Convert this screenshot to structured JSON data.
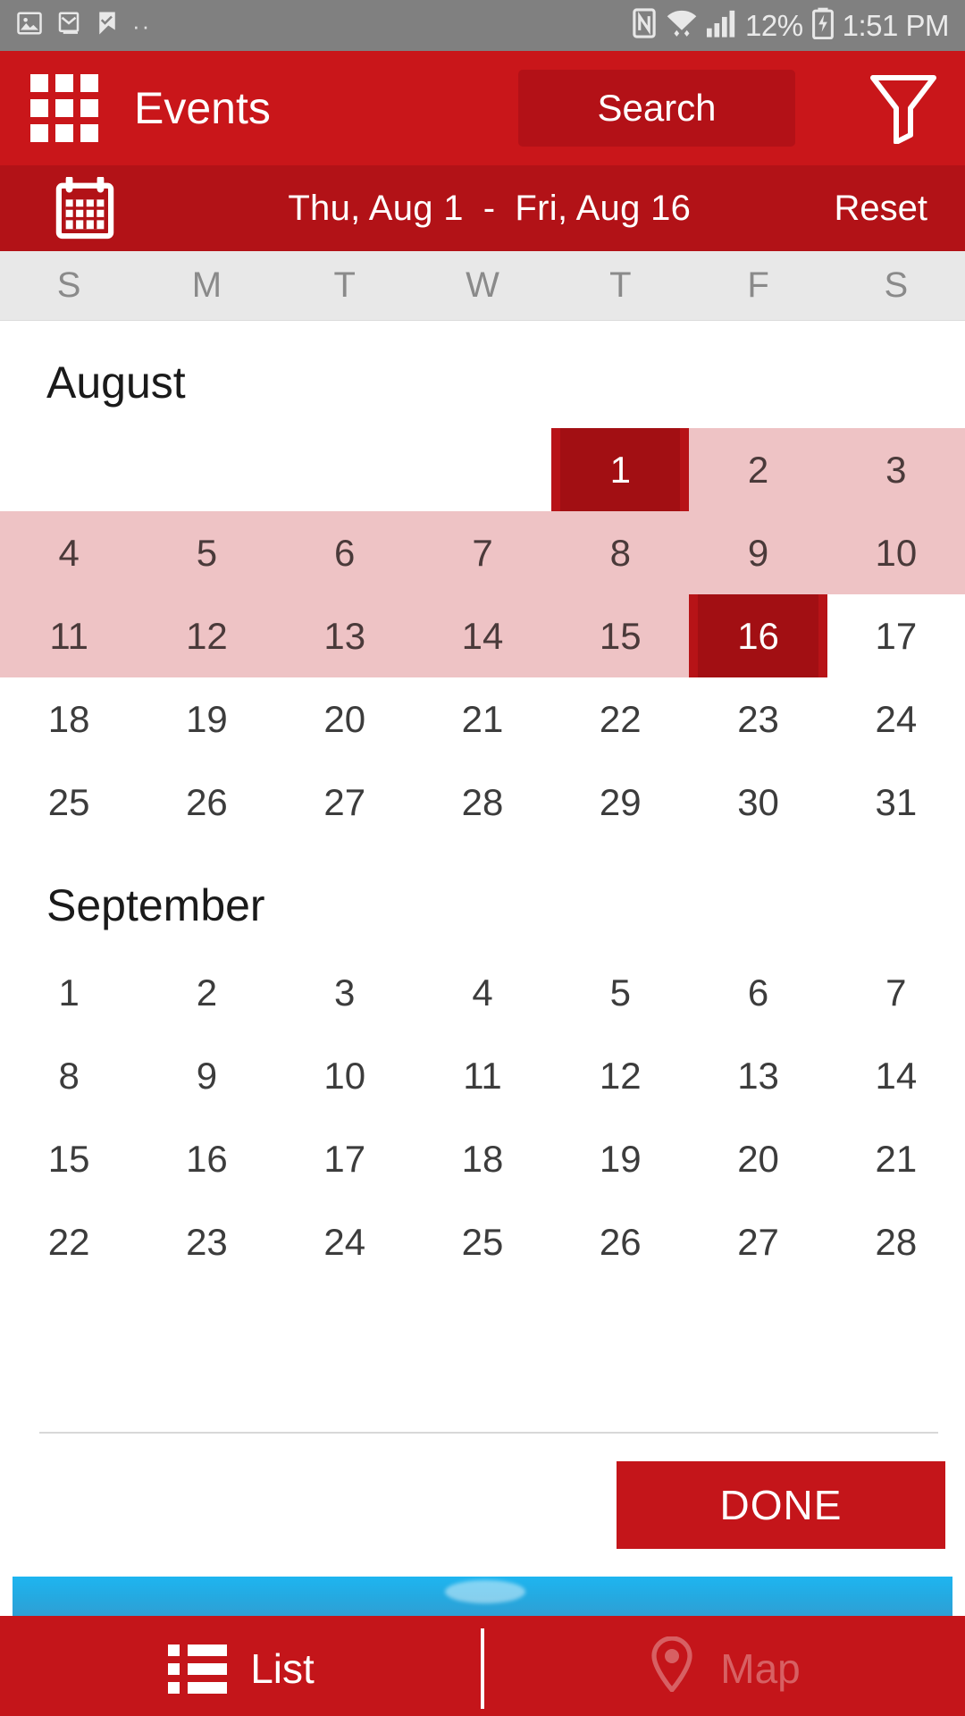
{
  "status_bar": {
    "battery_percent": "12%",
    "time": "1:51 PM",
    "icons": [
      "image-icon",
      "gmail-icon",
      "checkmark-flag-icon",
      "more-dots-icon",
      "nfc-icon",
      "wifi-icon",
      "signal-icon",
      "battery-charging-icon"
    ],
    "background": "#808080"
  },
  "app_bar": {
    "menu_icon": "grid-menu-icon",
    "title": "Events",
    "search_label": "Search",
    "filter_icon": "filter-funnel-icon",
    "background": "#c9161a",
    "search_background": "#b31117"
  },
  "date_bar": {
    "calendar_icon": "calendar-icon",
    "start_date": "Thu, Aug 1",
    "separator": "-",
    "end_date": "Fri, Aug 16",
    "reset_label": "Reset",
    "background": "#b21217"
  },
  "weekday_header": {
    "labels": [
      "S",
      "M",
      "T",
      "W",
      "T",
      "F",
      "S"
    ],
    "background": "#e8e8e8",
    "text_color": "#8a8a8a"
  },
  "calendar": {
    "range_color": "#eec3c5",
    "endpoint_color": "#a20f13",
    "months": [
      {
        "name": "August",
        "weeks": [
          [
            {
              "day": "",
              "state": "empty"
            },
            {
              "day": "",
              "state": "empty"
            },
            {
              "day": "",
              "state": "empty"
            },
            {
              "day": "",
              "state": "empty"
            },
            {
              "day": "1",
              "state": "endpoint"
            },
            {
              "day": "2",
              "state": "in-range"
            },
            {
              "day": "3",
              "state": "in-range"
            }
          ],
          [
            {
              "day": "4",
              "state": "in-range"
            },
            {
              "day": "5",
              "state": "in-range"
            },
            {
              "day": "6",
              "state": "in-range"
            },
            {
              "day": "7",
              "state": "in-range"
            },
            {
              "day": "8",
              "state": "in-range"
            },
            {
              "day": "9",
              "state": "in-range"
            },
            {
              "day": "10",
              "state": "in-range"
            }
          ],
          [
            {
              "day": "11",
              "state": "in-range"
            },
            {
              "day": "12",
              "state": "in-range"
            },
            {
              "day": "13",
              "state": "in-range"
            },
            {
              "day": "14",
              "state": "in-range"
            },
            {
              "day": "15",
              "state": "in-range"
            },
            {
              "day": "16",
              "state": "endpoint"
            },
            {
              "day": "17",
              "state": "normal"
            }
          ],
          [
            {
              "day": "18",
              "state": "normal"
            },
            {
              "day": "19",
              "state": "normal"
            },
            {
              "day": "20",
              "state": "normal"
            },
            {
              "day": "21",
              "state": "normal"
            },
            {
              "day": "22",
              "state": "normal"
            },
            {
              "day": "23",
              "state": "normal"
            },
            {
              "day": "24",
              "state": "normal"
            }
          ],
          [
            {
              "day": "25",
              "state": "normal"
            },
            {
              "day": "26",
              "state": "normal"
            },
            {
              "day": "27",
              "state": "normal"
            },
            {
              "day": "28",
              "state": "normal"
            },
            {
              "day": "29",
              "state": "normal"
            },
            {
              "day": "30",
              "state": "normal"
            },
            {
              "day": "31",
              "state": "normal"
            }
          ]
        ]
      },
      {
        "name": "September",
        "weeks": [
          [
            {
              "day": "1",
              "state": "normal"
            },
            {
              "day": "2",
              "state": "normal"
            },
            {
              "day": "3",
              "state": "normal"
            },
            {
              "day": "4",
              "state": "normal"
            },
            {
              "day": "5",
              "state": "normal"
            },
            {
              "day": "6",
              "state": "normal"
            },
            {
              "day": "7",
              "state": "normal"
            }
          ],
          [
            {
              "day": "8",
              "state": "normal"
            },
            {
              "day": "9",
              "state": "normal"
            },
            {
              "day": "10",
              "state": "normal"
            },
            {
              "day": "11",
              "state": "normal"
            },
            {
              "day": "12",
              "state": "normal"
            },
            {
              "day": "13",
              "state": "normal"
            },
            {
              "day": "14",
              "state": "normal"
            }
          ],
          [
            {
              "day": "15",
              "state": "normal"
            },
            {
              "day": "16",
              "state": "normal"
            },
            {
              "day": "17",
              "state": "normal"
            },
            {
              "day": "18",
              "state": "normal"
            },
            {
              "day": "19",
              "state": "normal"
            },
            {
              "day": "20",
              "state": "normal"
            },
            {
              "day": "21",
              "state": "normal"
            }
          ],
          [
            {
              "day": "22",
              "state": "normal"
            },
            {
              "day": "23",
              "state": "normal"
            },
            {
              "day": "24",
              "state": "normal"
            },
            {
              "day": "25",
              "state": "normal"
            },
            {
              "day": "26",
              "state": "normal"
            },
            {
              "day": "27",
              "state": "normal"
            },
            {
              "day": "28",
              "state": "normal"
            }
          ]
        ]
      }
    ]
  },
  "done_bar": {
    "label": "DONE",
    "background": "#c4151a"
  },
  "bottom_nav": {
    "background": "#c4151a",
    "tabs": [
      {
        "label": "List",
        "icon": "list-icon",
        "active": true
      },
      {
        "label": "Map",
        "icon": "map-pin-icon",
        "active": false
      }
    ]
  }
}
